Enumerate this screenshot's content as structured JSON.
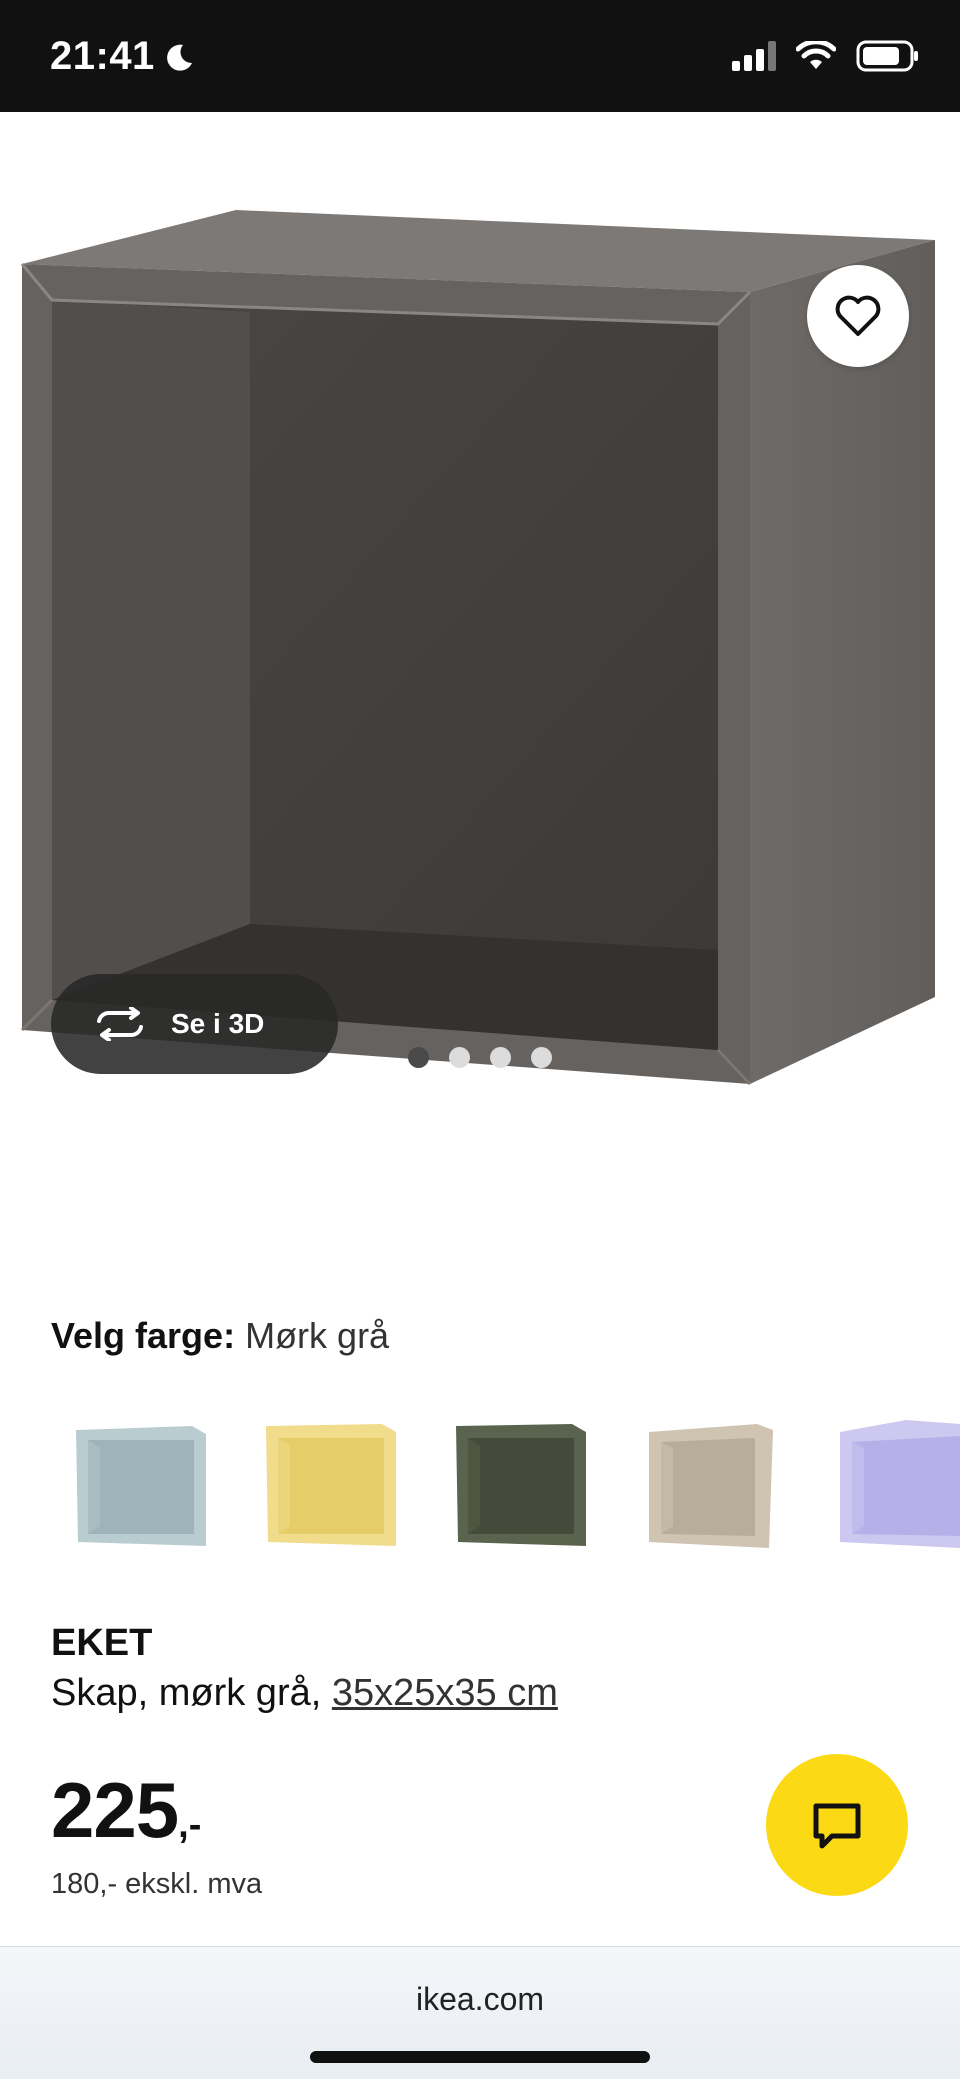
{
  "status_bar": {
    "time": "21:41",
    "icons": [
      "moon-icon",
      "cellular-signal-icon",
      "wifi-icon",
      "battery-icon"
    ]
  },
  "product_image": {
    "carousel_total": 4,
    "carousel_active": 1,
    "view_3d_label": "Se i 3D",
    "favorite_icon": "heart-icon"
  },
  "color_selector": {
    "label": "Velg farge:",
    "selected": "Mørk grå",
    "swatches": [
      {
        "name": "light-blue",
        "color": "#b9cdd1"
      },
      {
        "name": "yellow",
        "color": "#f0dc8a"
      },
      {
        "name": "dark-green",
        "color": "#5a634e"
      },
      {
        "name": "beige",
        "color": "#cfc4b2"
      },
      {
        "name": "lilac",
        "color": "#cdc8f0"
      }
    ]
  },
  "product": {
    "name": "EKET",
    "description": "Skap, mørk grå,",
    "dimensions": "35x25x35 cm",
    "price": "225",
    "price_suffix": ",-",
    "price_ex_vat": "180,- ekskl. mva"
  },
  "chat": {
    "icon": "chat-bubble-icon",
    "color": "#fbd914"
  },
  "browser": {
    "url": "ikea.com"
  }
}
